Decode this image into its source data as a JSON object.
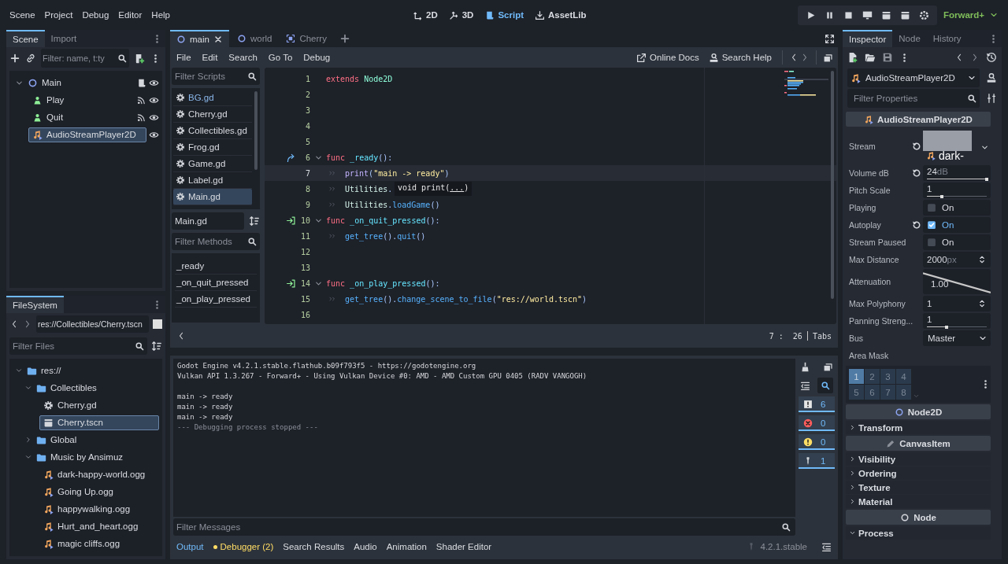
{
  "menu": [
    "Scene",
    "Project",
    "Debug",
    "Editor",
    "Help"
  ],
  "workspaces": [
    {
      "label": "2D",
      "kind": "planar",
      "selected": false
    },
    {
      "label": "3D",
      "kind": "spatial",
      "selected": false
    },
    {
      "label": "Script",
      "kind": "script",
      "selected": true
    },
    {
      "label": "AssetLib",
      "kind": "assetlib",
      "selected": false
    }
  ],
  "renderer": "Forward+",
  "scene_dock": {
    "tabs": [
      {
        "label": "Scene",
        "selected": true
      },
      {
        "label": "Import",
        "selected": false
      }
    ],
    "filter": {
      "placeholder": "Filter: name, t:ty"
    },
    "tree": [
      {
        "name": "Main",
        "kind": "node2d",
        "selected": false,
        "expanded": true,
        "script": true,
        "signals": false,
        "children": [
          {
            "name": "Play",
            "kind": "button",
            "selected": false,
            "script": false,
            "signals": true
          },
          {
            "name": "Quit",
            "kind": "button",
            "selected": false,
            "script": false,
            "signals": true
          },
          {
            "name": "AudioStreamPlayer2D",
            "kind": "audio",
            "selected": true,
            "script": false,
            "signals": false
          }
        ]
      }
    ]
  },
  "filesystem": {
    "tab": "FileSystem",
    "path": "res://Collectibles/Cherry.tscn",
    "filter": {
      "placeholder": "Filter Files"
    },
    "tree": [
      {
        "name": "res://",
        "kind": "folder",
        "expanded": true,
        "selected": false,
        "children": [
          {
            "name": "Collectibles",
            "kind": "folder",
            "expanded": true,
            "selected": false,
            "children": [
              {
                "name": "Cherry.gd",
                "kind": "script",
                "selected": false
              },
              {
                "name": "Cherry.tscn",
                "kind": "scene",
                "selected": true
              }
            ]
          },
          {
            "name": "Global",
            "kind": "folder",
            "expanded": false,
            "selected": false
          },
          {
            "name": "Music by Ansimuz",
            "kind": "folder",
            "expanded": true,
            "selected": false,
            "children": [
              {
                "name": "dark-happy-world.ogg",
                "kind": "audio",
                "selected": false
              },
              {
                "name": "Going Up.ogg",
                "kind": "audio",
                "selected": false
              },
              {
                "name": "happywalking.ogg",
                "kind": "audio",
                "selected": false
              },
              {
                "name": "Hurt_and_heart.ogg",
                "kind": "audio",
                "selected": false
              },
              {
                "name": "magic cliffs.ogg",
                "kind": "audio",
                "selected": false
              }
            ]
          }
        ]
      }
    ]
  },
  "editor_tabs": [
    {
      "label": "main",
      "kind": "node2d",
      "selected": true
    },
    {
      "label": "world",
      "kind": "node2d",
      "selected": false
    },
    {
      "label": "Cherry",
      "kind": "area",
      "selected": false
    }
  ],
  "script_menu": [
    "File",
    "Edit",
    "Search",
    "Go To",
    "Debug"
  ],
  "help_buttons": [
    {
      "label": "Online Docs",
      "kind": "docs"
    },
    {
      "label": "Search Help",
      "kind": "help"
    }
  ],
  "scripts": {
    "filter": {
      "placeholder": "Filter Scripts"
    },
    "items": [
      {
        "label": "BG.gd",
        "highlighted": true,
        "selected": false
      },
      {
        "label": "Cherry.gd",
        "highlighted": false,
        "selected": false
      },
      {
        "label": "Collectibles.gd",
        "highlighted": false,
        "selected": false
      },
      {
        "label": "Frog.gd",
        "highlighted": false,
        "selected": false
      },
      {
        "label": "Game.gd",
        "highlighted": false,
        "selected": false
      },
      {
        "label": "Label.gd",
        "highlighted": false,
        "selected": false
      },
      {
        "label": "Main.gd",
        "highlighted": false,
        "selected": true
      }
    ],
    "current": "Main.gd",
    "methods_filter": {
      "placeholder": "Filter Methods"
    },
    "methods": [
      "_ready",
      "_on_quit_pressed",
      "_on_play_pressed"
    ]
  },
  "code": [
    {
      "number": "1",
      "current": false,
      "segments": [
        {
          "kind": "keyword",
          "text": "extends"
        },
        {
          "kind": "type",
          "text": "Node2D"
        }
      ]
    },
    {
      "number": "2",
      "current": false
    },
    {
      "number": "3",
      "current": false
    },
    {
      "number": "4",
      "current": false
    },
    {
      "number": "5",
      "current": false
    },
    {
      "number": "6",
      "current": false,
      "gutter": {
        "kind": "override"
      },
      "fold": true,
      "segments": [
        {
          "kind": "keyword",
          "text": "func"
        },
        {
          "kind": "funcdef",
          "text": "_ready"
        },
        {
          "kind": "symbol",
          "text": "():"
        }
      ]
    },
    {
      "number": "7",
      "current": true,
      "indented": true,
      "segments": [
        {
          "kind": "builtin",
          "text": "print"
        },
        {
          "kind": "symbol",
          "text": "("
        },
        {
          "kind": "string",
          "text": "\"main -> ready\""
        },
        {
          "kind": "symbol",
          "text": ")"
        }
      ]
    },
    {
      "number": "8",
      "current": false,
      "indented": true,
      "segments": [
        {
          "kind": "class",
          "text": "Utilities"
        },
        {
          "kind": "symbol",
          "text": "."
        }
      ]
    },
    {
      "number": "9",
      "current": false,
      "indented": true,
      "segments": [
        {
          "kind": "class",
          "text": "Utilities"
        },
        {
          "kind": "symbol",
          "text": "."
        },
        {
          "kind": "call",
          "text": "loadGame"
        },
        {
          "kind": "symbol",
          "text": "()"
        }
      ]
    },
    {
      "number": "10",
      "current": false,
      "gutter": {
        "kind": "signal"
      },
      "fold": true,
      "segments": [
        {
          "kind": "keyword",
          "text": "func"
        },
        {
          "kind": "funcdef",
          "text": "_on_quit_pressed"
        },
        {
          "kind": "symbol",
          "text": "():"
        }
      ]
    },
    {
      "number": "11",
      "current": false,
      "indented": true,
      "segments": [
        {
          "kind": "call",
          "text": "get_tree"
        },
        {
          "kind": "symbol",
          "text": "()."
        },
        {
          "kind": "call",
          "text": "quit"
        },
        {
          "kind": "symbol",
          "text": "()"
        }
      ]
    },
    {
      "number": "12",
      "current": false
    },
    {
      "number": "13",
      "current": false
    },
    {
      "number": "14",
      "current": false,
      "gutter": {
        "kind": "signal"
      },
      "fold": true,
      "segments": [
        {
          "kind": "keyword",
          "text": "func"
        },
        {
          "kind": "funcdef",
          "text": "_on_play_pressed"
        },
        {
          "kind": "symbol",
          "text": "():"
        }
      ]
    },
    {
      "number": "15",
      "current": false,
      "indented": true,
      "segments": [
        {
          "kind": "call",
          "text": "get_tree"
        },
        {
          "kind": "symbol",
          "text": "()."
        },
        {
          "kind": "call",
          "text": "change_scene_to_file"
        },
        {
          "kind": "symbol",
          "text": "("
        },
        {
          "kind": "string",
          "text": "\"res://world.tscn\""
        },
        {
          "kind": "symbol",
          "text": ")"
        }
      ]
    },
    {
      "number": "16",
      "current": false
    }
  ],
  "tooltip": {
    "signature": "void print(",
    "argument": "...",
    "close": ")"
  },
  "status": {
    "position": "7 :  26",
    "indent_mode": "Tabs"
  },
  "output": {
    "blocks": [
      [
        {
          "text": "Godot Engine v4.2.1.stable.flathub.b09f793f5 - https://godotengine.org",
          "kind": "info"
        },
        {
          "text": "Vulkan API 1.3.267 - Forward+ - Using Vulkan Device #0: AMD - AMD Custom GPU 0405 (RADV VANGOGH)",
          "kind": "info"
        }
      ],
      [
        {
          "text": "main -> ready",
          "kind": "info"
        },
        {
          "text": "main -> ready",
          "kind": "info"
        },
        {
          "text": "main -> ready",
          "kind": "info"
        },
        {
          "text": "--- Debugging process stopped ---",
          "kind": "dim"
        }
      ]
    ],
    "counters": [
      {
        "kind": "messages",
        "count": "6",
        "on": true
      },
      {
        "kind": "errors",
        "count": "0",
        "on": true
      },
      {
        "kind": "warnings",
        "count": "0",
        "on": true
      },
      {
        "kind": "editor",
        "count": "1",
        "on": true
      }
    ],
    "filter": {
      "placeholder": "Filter Messages"
    }
  },
  "bottom_tabs": [
    {
      "label": "Output",
      "selected": true,
      "alert": false
    },
    {
      "label": "Debugger (2)",
      "selected": false,
      "alert": true
    },
    {
      "label": "Search Results",
      "selected": false,
      "alert": false
    },
    {
      "label": "Audio",
      "selected": false,
      "alert": false
    },
    {
      "label": "Animation",
      "selected": false,
      "alert": false
    },
    {
      "label": "Shader Editor",
      "selected": false,
      "alert": false
    }
  ],
  "version": "4.2.1.stable",
  "inspector": {
    "tabs": [
      {
        "label": "Inspector",
        "selected": true
      },
      {
        "label": "Node",
        "selected": false
      },
      {
        "label": "History",
        "selected": false
      }
    ],
    "object": "AudioStreamPlayer2D",
    "filter": {
      "placeholder": "Filter Properties"
    },
    "rows": [
      {
        "kind": "category",
        "label": "AudioStreamPlayer2D",
        "node": {
          "kind": "audio"
        }
      },
      {
        "kind": "resource",
        "label": "Stream",
        "value": "dark-",
        "revertable": true
      },
      {
        "kind": "slider",
        "label": "Volume dB",
        "value": "24",
        "unit": "dB",
        "level": 1.0,
        "revertable": true
      },
      {
        "kind": "slider",
        "label": "Pitch Scale",
        "value": "1",
        "level": 0.25,
        "revertable": false
      },
      {
        "kind": "check",
        "label": "Playing",
        "text": "On",
        "checked": false,
        "revertable": false
      },
      {
        "kind": "check",
        "label": "Autoplay",
        "text": "On",
        "checked": true,
        "revertable": true
      },
      {
        "kind": "check",
        "label": "Stream Paused",
        "text": "On",
        "checked": false,
        "revertable": false
      },
      {
        "kind": "spin",
        "label": "Max Distance",
        "value": "2000",
        "unit": "px",
        "revertable": false
      },
      {
        "kind": "curve",
        "label": "Attenuation",
        "value": "1.00",
        "revertable": false
      },
      {
        "kind": "spin",
        "label": "Max Polyphony",
        "value": "1",
        "revertable": false
      },
      {
        "kind": "slider",
        "label": "Panning Streng...",
        "value": "1",
        "level": 0.33,
        "revertable": false
      },
      {
        "kind": "enum",
        "label": "Bus",
        "value": "Master",
        "revertable": false
      },
      {
        "kind": "mask",
        "label": "Area Mask",
        "bits": [
          {
            "label": "1",
            "on": true
          },
          {
            "label": "2",
            "on": false
          },
          {
            "label": "3",
            "on": false
          },
          {
            "label": "4",
            "on": false
          },
          {
            "label": "5",
            "on": false
          },
          {
            "label": "6",
            "on": false
          },
          {
            "label": "7",
            "on": false
          },
          {
            "label": "8",
            "on": false
          }
        ]
      },
      {
        "kind": "category",
        "label": "Node2D",
        "node": {
          "kind": "node2d"
        }
      },
      {
        "kind": "group",
        "label": "Transform",
        "expanded": false
      },
      {
        "kind": "category",
        "label": "CanvasItem",
        "node": {
          "kind": "canvasitem"
        }
      },
      {
        "kind": "group",
        "label": "Visibility",
        "expanded": false
      },
      {
        "kind": "group",
        "label": "Ordering",
        "expanded": false
      },
      {
        "kind": "group",
        "label": "Texture",
        "expanded": false
      },
      {
        "kind": "group",
        "label": "Material",
        "expanded": false
      },
      {
        "kind": "category",
        "label": "Node",
        "node": {
          "kind": "node"
        }
      },
      {
        "kind": "group",
        "label": "Process",
        "expanded": true
      }
    ]
  }
}
